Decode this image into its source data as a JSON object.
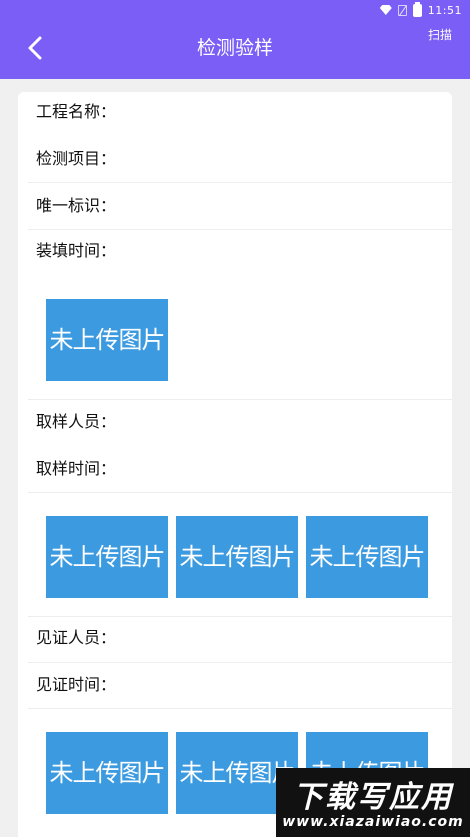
{
  "status_bar": {
    "time": "11:51"
  },
  "header": {
    "title": "检测验样",
    "scan_label": "扫描"
  },
  "info": {
    "project_name_label": "工程名称：",
    "test_item_label": "检测项目：",
    "unique_id_label": "唯一标识：",
    "filling_time_label": "装填时间："
  },
  "sampling": {
    "person_label": "取样人员：",
    "time_label": "取样时间："
  },
  "witness": {
    "person_label": "见证人员：",
    "time_label": "见证时间："
  },
  "placeholder_image_text": "未上传图片",
  "watermark": {
    "main": "下载写应用",
    "sub": "www.xiazaiwiao.com"
  },
  "colors": {
    "header": "#7b5ef5",
    "photo": "#3c9be0"
  }
}
